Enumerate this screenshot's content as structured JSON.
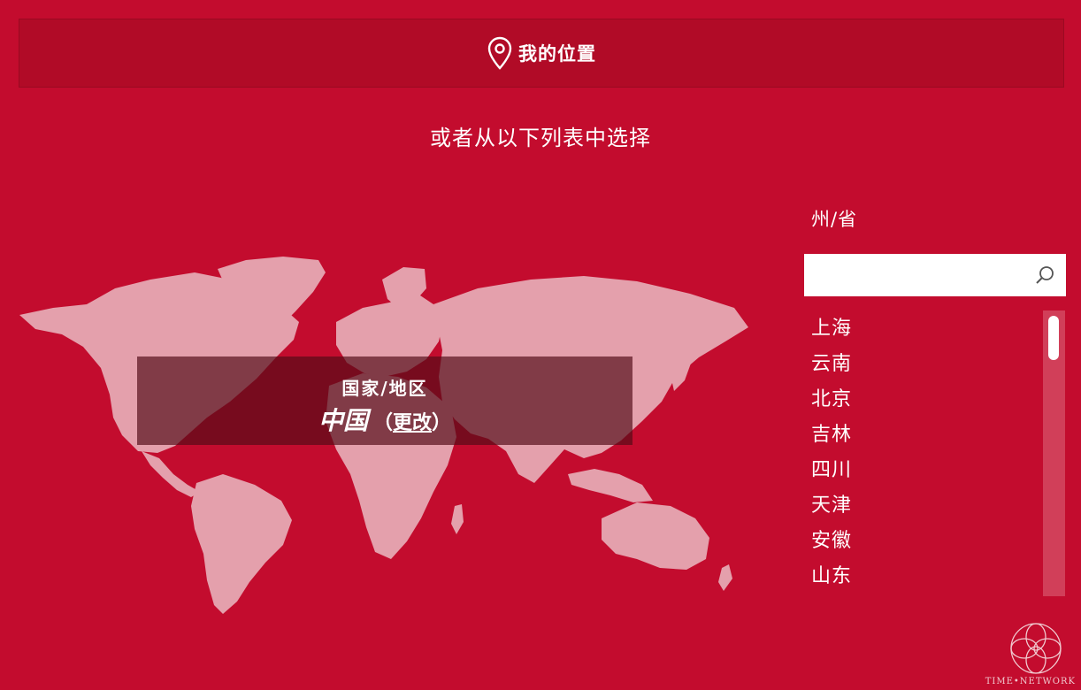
{
  "header": {
    "icon": "location-pin-icon",
    "label": "我的位置"
  },
  "hint": "或者从以下列表中选择",
  "country": {
    "label": "国家/地区",
    "name": "中国",
    "change_open": "（",
    "change_label": "更改",
    "change_close": "）"
  },
  "state": {
    "label": "州/省",
    "search_placeholder": "",
    "search_icon": "search-icon",
    "items": [
      "上海",
      "云南",
      "北京",
      "吉林",
      "四川",
      "天津",
      "安徽",
      "山东"
    ]
  },
  "brand": {
    "logo_icon": "knot-logo-icon",
    "name": "TIME•NETWORK"
  },
  "colors": {
    "background": "#c30c2e",
    "header_bar": "#b10b27",
    "map_land": "#e4a0ac",
    "overlay": "#520c18",
    "scroll_track": "#d13f59"
  }
}
